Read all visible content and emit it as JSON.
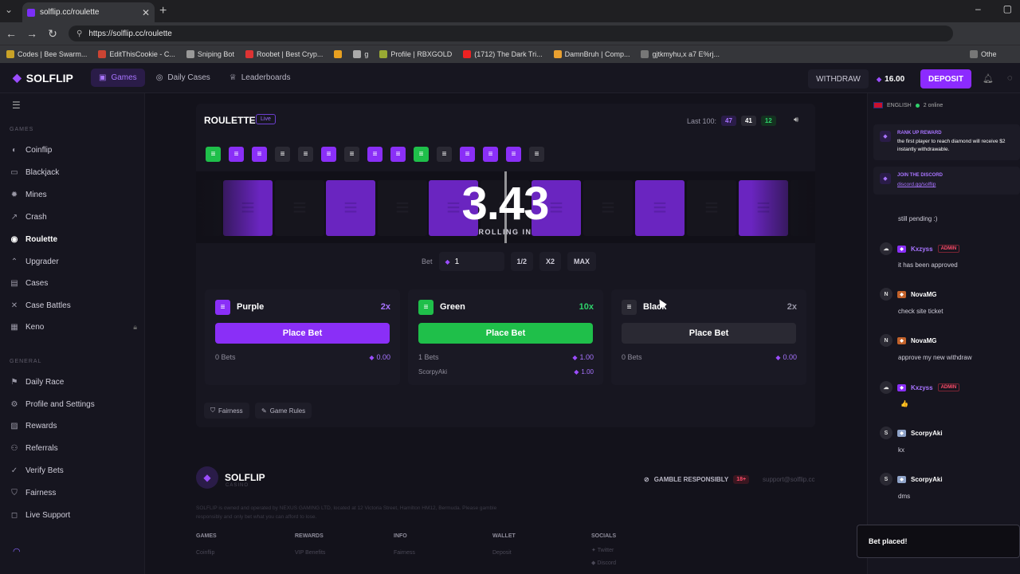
{
  "browser": {
    "tab_title": "solflip.cc/roulette",
    "url": "https://solflip.cc/roulette",
    "bookmarks": [
      "Codes | Bee Swarm...",
      "EditThisCookie - C...",
      "Sniping Bot",
      "Roobet | Best Cryp...",
      "g",
      "Profile | RBXGOLD",
      "(1712) The Dark Tri...",
      "DamnBruh | Comp...",
      "gjtkmyhu,x a7 E%rj...",
      "Othe"
    ]
  },
  "header": {
    "logo": "SOLFLIP",
    "nav": [
      "Games",
      "Daily Cases",
      "Leaderboards"
    ],
    "withdraw": "WITHDRAW",
    "balance": "16.00",
    "deposit": "DEPOSIT"
  },
  "sidebar": {
    "games_title": "GAMES",
    "games": [
      "Coinflip",
      "Blackjack",
      "Mines",
      "Crash",
      "Roulette",
      "Upgrader",
      "Cases",
      "Case Battles",
      "Keno"
    ],
    "general_title": "GENERAL",
    "general": [
      "Daily Race",
      "Profile and Settings",
      "Rewards",
      "Referrals",
      "Verify Bets",
      "Fairness",
      "Live Support"
    ]
  },
  "roulette": {
    "title": "ROULETTE",
    "live": "Live",
    "last100_label": "Last 100:",
    "last100": {
      "purple": "47",
      "black": "41",
      "green": "12"
    },
    "history": [
      "g",
      "p",
      "p",
      "b",
      "b",
      "p",
      "b",
      "p",
      "p",
      "g",
      "b",
      "p",
      "p",
      "p",
      "b"
    ],
    "roll_value": "3.43",
    "roll_label": "ROLLING IN",
    "bet_label": "Bet",
    "bet_value": "1",
    "bet_buttons": [
      "1/2",
      "X2",
      "MAX"
    ],
    "cards": [
      {
        "name": "Purple",
        "mult": "2x",
        "button": "Place Bet",
        "bets": "0 Bets",
        "total": "0.00",
        "color": "#8a2ff7"
      },
      {
        "name": "Green",
        "mult": "10x",
        "button": "Place Bet",
        "bets": "1 Bets",
        "total": "1.00",
        "player": "ScorpyAki",
        "player_amount": "1.00",
        "color": "#1fbf4a"
      },
      {
        "name": "Black",
        "mult": "2x",
        "button": "Place Bet",
        "bets": "0 Bets",
        "total": "0.00",
        "color": "#2a2933"
      }
    ],
    "fairness": "Fairness",
    "game_rules": "Game Rules"
  },
  "footer": {
    "logo": "SOLFLIP",
    "sub": "CASINO",
    "gamble": "GAMBLE RESPONSIBLY",
    "age": "18+",
    "email": "support@solflip.cc",
    "legal": "SOLFLIP is owned and operated by NEXUS GAMING LTD, located at 12 Victoria Street, Hamilton HM12, Bermuda. Please gamble responsibly and only bet what you can afford to lose.",
    "cols": [
      "GAMES",
      "REWARDS",
      "INFO",
      "WALLET",
      "SOCIALS"
    ],
    "links": [
      "Coinflip",
      "VIP Benefits",
      "Fairness",
      "Deposit",
      "Twitter",
      "Discord"
    ]
  },
  "chat": {
    "language": "ENGLISH",
    "online": "2 online",
    "notice1_title": "RANK UP REWARD",
    "notice1_body": "the first player to reach diamond will receive $2 instantly withdrawable.",
    "notice2_title": "JOIN THE DISCORD",
    "notice2_body": "discord.gg/solflip",
    "messages": [
      {
        "user": "",
        "text": "still pending :)"
      },
      {
        "user": "Kxzyss",
        "admin": "ADMIN",
        "text": "it has been approved"
      },
      {
        "user": "NovaMG",
        "text": "check site ticket"
      },
      {
        "user": "NovaMG",
        "text": "approve my new withdraw"
      },
      {
        "user": "Kxzyss",
        "admin": "ADMIN",
        "text": "👍"
      },
      {
        "user": "ScorpyAki",
        "text": "kx"
      },
      {
        "user": "ScorpyAki",
        "text": "dms"
      }
    ],
    "toast": "Bet placed!"
  }
}
